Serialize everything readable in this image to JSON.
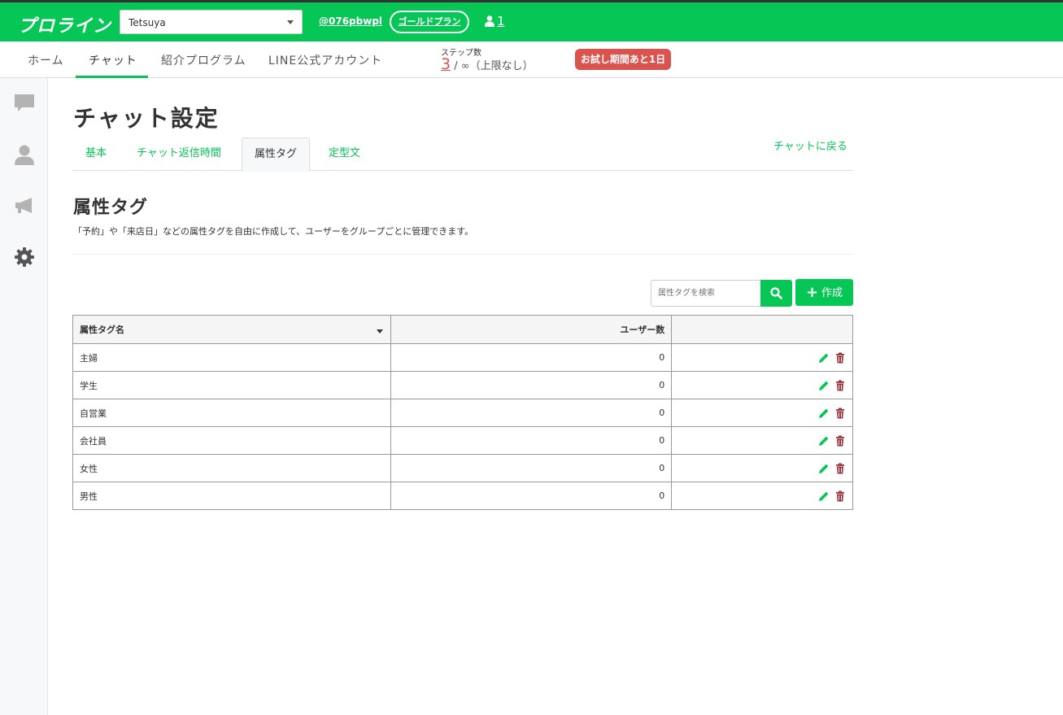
{
  "header": {
    "logo": "プロライン",
    "account_select": "Tetsuya",
    "line_id": "@076pbwpl",
    "plan": "ゴールドプラン",
    "user_count": "1"
  },
  "nav": {
    "items": [
      {
        "label": "ホーム"
      },
      {
        "label": "チャット"
      },
      {
        "label": "紹介プログラム"
      },
      {
        "label": "LINE公式アカウント"
      }
    ],
    "active": "チャット",
    "step_label": "ステップ数",
    "step_current": "3",
    "step_sep": "/ ∞（上限なし）",
    "trial_badge": "お試し期間あと1日"
  },
  "sidebar": {
    "icons": [
      "chat-bubble-icon",
      "user-icon",
      "megaphone-icon",
      "gear-icon"
    ]
  },
  "page": {
    "title": "チャット設定",
    "back_link": "チャットに戻る",
    "tabs": [
      {
        "label": "基本"
      },
      {
        "label": "チャット返信時間"
      },
      {
        "label": "属性タグ"
      },
      {
        "label": "定型文"
      }
    ],
    "active_tab": "属性タグ"
  },
  "section": {
    "title": "属性タグ",
    "description": "「予約」や「来店日」などの属性タグを自由に作成して、ユーザーをグループごとに管理できます。"
  },
  "toolbar": {
    "search_placeholder": "属性タグを検索",
    "create_label": "作成"
  },
  "table": {
    "headers": {
      "name": "属性タグ名",
      "users": "ユーザー数",
      "actions": ""
    },
    "rows": [
      {
        "name": "主婦",
        "users": "0"
      },
      {
        "name": "学生",
        "users": "0"
      },
      {
        "name": "自営業",
        "users": "0"
      },
      {
        "name": "会社員",
        "users": "0"
      },
      {
        "name": "女性",
        "users": "0"
      },
      {
        "name": "男性",
        "users": "0"
      }
    ]
  },
  "colors": {
    "brand": "#06c755",
    "danger": "#d9534f",
    "delete_icon": "#a0303a"
  }
}
